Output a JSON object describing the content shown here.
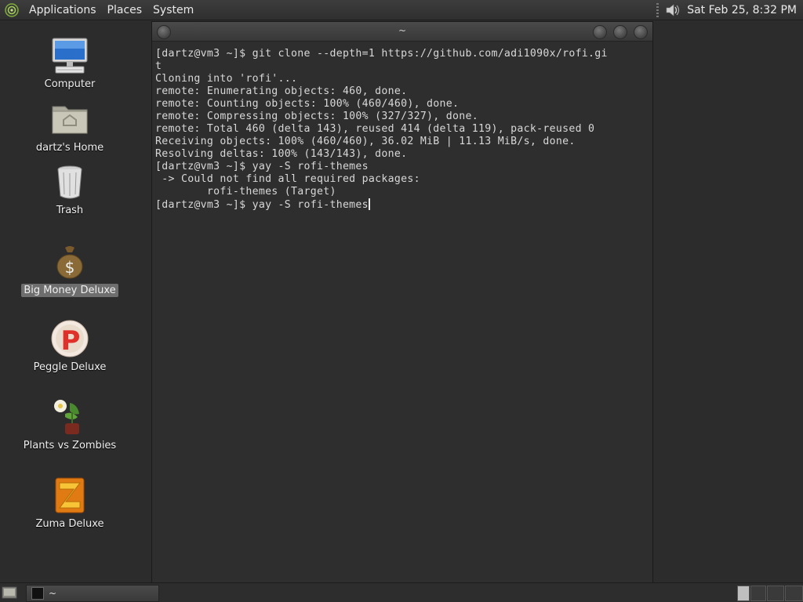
{
  "top_panel": {
    "menus": [
      "Applications",
      "Places",
      "System"
    ],
    "clock": "Sat Feb 25,  8:32 PM",
    "icons": {
      "logo": "distro-logo-icon",
      "volume": "speaker-volume-icon"
    }
  },
  "desktop": {
    "icons": [
      {
        "label": "Computer",
        "icon": "computer-icon"
      },
      {
        "label": "dartz's Home",
        "icon": "home-folder-icon"
      },
      {
        "label": "Trash",
        "icon": "trash-icon"
      },
      {
        "label": "Big Money Deluxe",
        "icon": "money-bag-icon",
        "selected": true
      },
      {
        "label": "Peggle Deluxe",
        "icon": "peggle-icon"
      },
      {
        "label": "Plants vs Zombies",
        "icon": "plants-vs-zombies-icon"
      },
      {
        "label": "Zuma Deluxe",
        "icon": "zuma-icon"
      }
    ]
  },
  "terminal": {
    "title": "~",
    "lines": [
      "[dartz@vm3 ~]$ git clone --depth=1 https://github.com/adi1090x/rofi.gi",
      "t",
      "Cloning into 'rofi'...",
      "remote: Enumerating objects: 460, done.",
      "remote: Counting objects: 100% (460/460), done.",
      "remote: Compressing objects: 100% (327/327), done.",
      "remote: Total 460 (delta 143), reused 414 (delta 119), pack-reused 0",
      "Receiving objects: 100% (460/460), 36.02 MiB | 11.13 MiB/s, done.",
      "Resolving deltas: 100% (143/143), done.",
      "[dartz@vm3 ~]$ yay -S rofi-themes",
      " -> Could not find all required packages:",
      "        rofi-themes (Target)"
    ],
    "prompt_line": "[dartz@vm3 ~]$ yay -S rofi-themes"
  },
  "bottom_panel": {
    "task_label": "~",
    "icons": {
      "show_desktop": "show-desktop-icon",
      "task": "terminal-icon"
    }
  }
}
